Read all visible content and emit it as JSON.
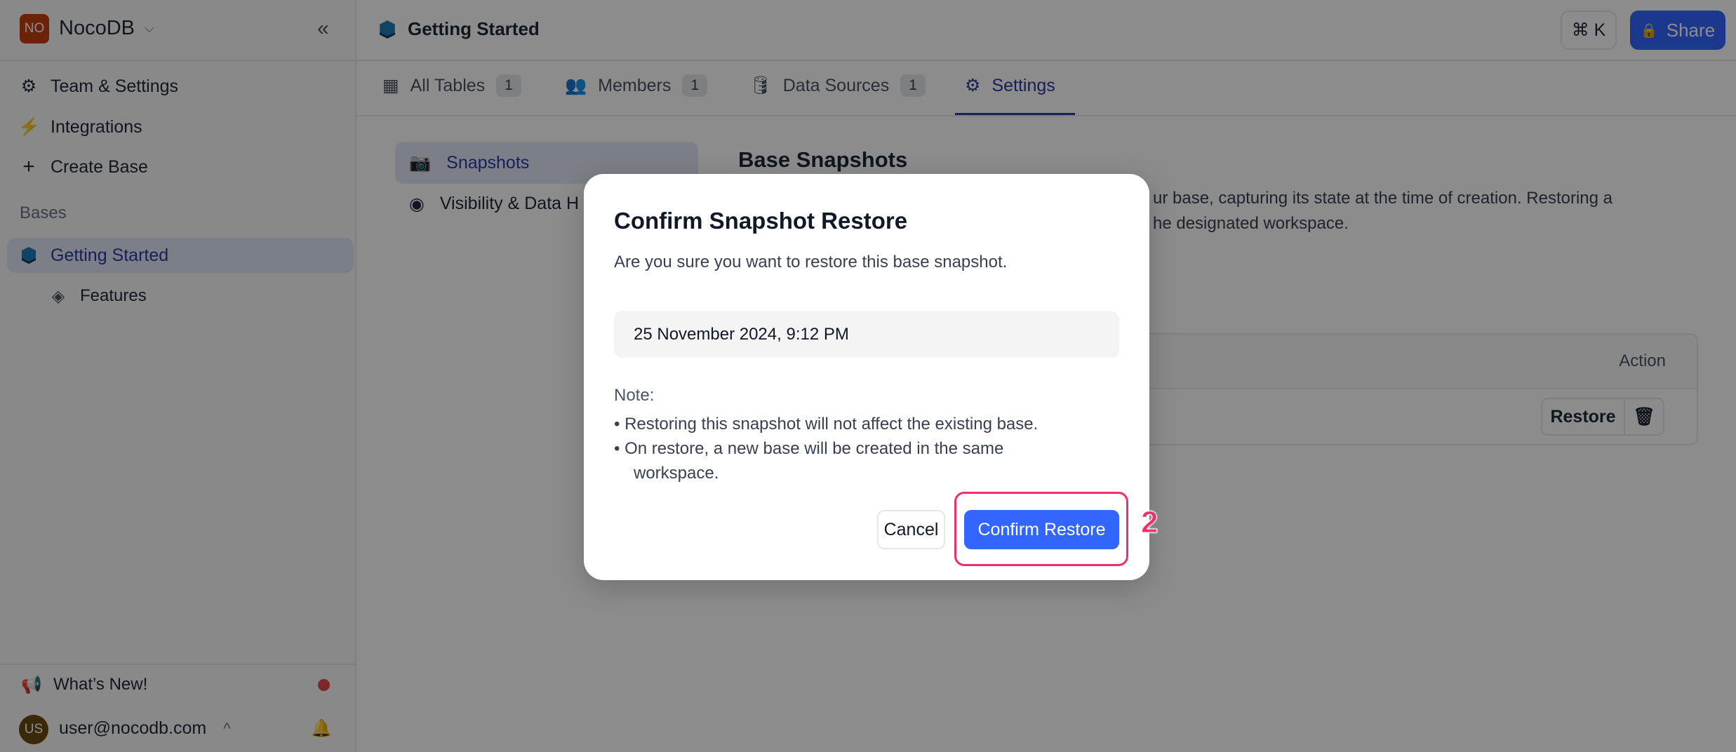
{
  "workspace": {
    "initials": "NO",
    "name": "NocoDB",
    "logo_color": "#c2410c"
  },
  "sidebar": {
    "items": [
      {
        "label": "Team & Settings",
        "icon": "gear-icon"
      },
      {
        "label": "Integrations",
        "icon": "plug-icon"
      },
      {
        "label": "Create Base",
        "icon": "plus-icon"
      }
    ],
    "section_label": "Bases",
    "bases": [
      {
        "label": "Getting Started",
        "active": true,
        "children": [
          {
            "label": "Features"
          }
        ]
      }
    ],
    "whats_new": "What’s New!",
    "user": {
      "initials": "US",
      "email": "user@nocodb.com"
    }
  },
  "header": {
    "title": "Getting Started",
    "cmdk": "⌘ K",
    "share": "Share"
  },
  "tabs": [
    {
      "label": "All Tables",
      "count": "1"
    },
    {
      "label": "Members",
      "count": "1"
    },
    {
      "label": "Data Sources",
      "count": "1"
    },
    {
      "label": "Settings",
      "active": true
    }
  ],
  "settings_nav": [
    {
      "label": "Snapshots",
      "active": true
    },
    {
      "label": "Visibility & Data H"
    }
  ],
  "content": {
    "title": "Base Snapshots",
    "desc_line1": "ur base, capturing its state at the time of creation. Restoring a",
    "desc_line2": "he designated workspace.",
    "table_action_header": "Action",
    "restore_label": "Restore"
  },
  "modal": {
    "title": "Confirm Snapshot Restore",
    "subtitle": "Are you sure you want to restore this base snapshot.",
    "snapshot_date": "25 November 2024, 9:12 PM",
    "note_label": "Note:",
    "notes": [
      "Restoring this snapshot will not affect the existing base.",
      "On restore, a new base will be created in the same",
      "workspace."
    ],
    "cancel": "Cancel",
    "confirm": "Confirm Restore"
  },
  "annotation": {
    "step": "2",
    "color": "#f0306a"
  },
  "colors": {
    "accent": "#3366ff",
    "nav_active": "#2b3a9e"
  }
}
